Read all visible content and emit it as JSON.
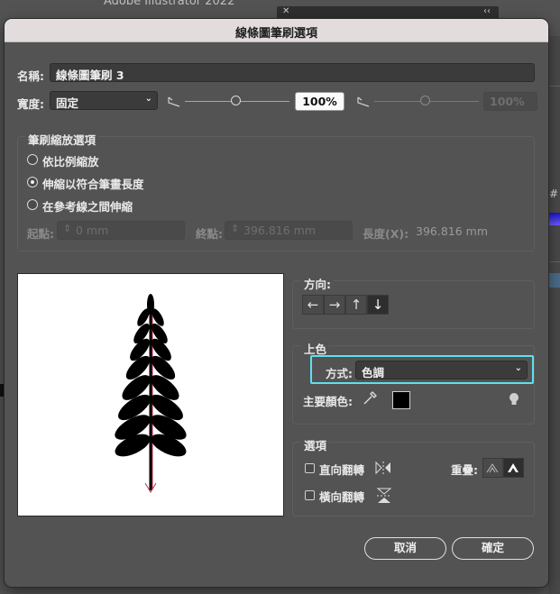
{
  "background_app": {
    "title": "Adobe Illustrator 2022",
    "close_glyph": "✕",
    "collapse_glyph": "‹‹",
    "hash": "#"
  },
  "dialog": {
    "title": "線條圖筆刷選項",
    "name_label": "名稱:",
    "name_value": "線條圖筆刷 3",
    "width_label": "寬度:",
    "width_mode": "固定",
    "width_percent": "100%",
    "width_var_percent": "100%",
    "scale_group": {
      "title": "筆刷縮放選項",
      "options": [
        "依比例縮放",
        "伸縮以符合筆畫長度",
        "在參考線之間伸縮"
      ],
      "selected_index": 1,
      "start_label": "起點:",
      "start_value": "0 mm",
      "end_label": "終點:",
      "end_value": "396.816 mm",
      "length_label": "長度(X):",
      "length_value": "396.816 mm"
    },
    "direction": {
      "title": "方向:",
      "buttons": [
        "←",
        "→",
        "↑",
        "↓"
      ],
      "selected_index": 3
    },
    "colorization": {
      "title": "上色",
      "method_label": "方式:",
      "method_value": "色調",
      "key_color_label": "主要顏色:",
      "key_color": "#000000"
    },
    "options": {
      "title": "選項",
      "flip_along_label": "直向翻轉",
      "flip_across_label": "橫向翻轉",
      "overlap_label": "重疊:"
    },
    "cancel_label": "取消",
    "ok_label": "確定"
  },
  "colors": {
    "highlight": "#5ee0ee",
    "stroke_guide": "#c0304a"
  }
}
